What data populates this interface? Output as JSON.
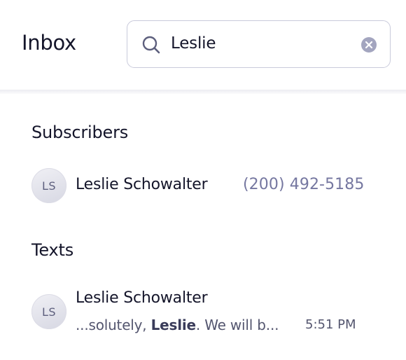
{
  "header": {
    "title": "Inbox",
    "search": {
      "value": "Leslie"
    }
  },
  "subscribers": {
    "title": "Subscribers",
    "items": [
      {
        "initials": "LS",
        "name": "Leslie Schowalter",
        "phone": "(200) 492-5185"
      }
    ]
  },
  "texts": {
    "title": "Texts",
    "items": [
      {
        "initials": "LS",
        "name": "Leslie Schowalter",
        "snippet_pre": "...solutely, ",
        "snippet_match": "Leslie",
        "snippet_post": ". We will b...",
        "time": "5:51 PM"
      }
    ]
  },
  "colors": {
    "text": "#14152a",
    "muted": "#7577a0",
    "border": "#c9cadb",
    "icon": "#5d5f7d"
  }
}
